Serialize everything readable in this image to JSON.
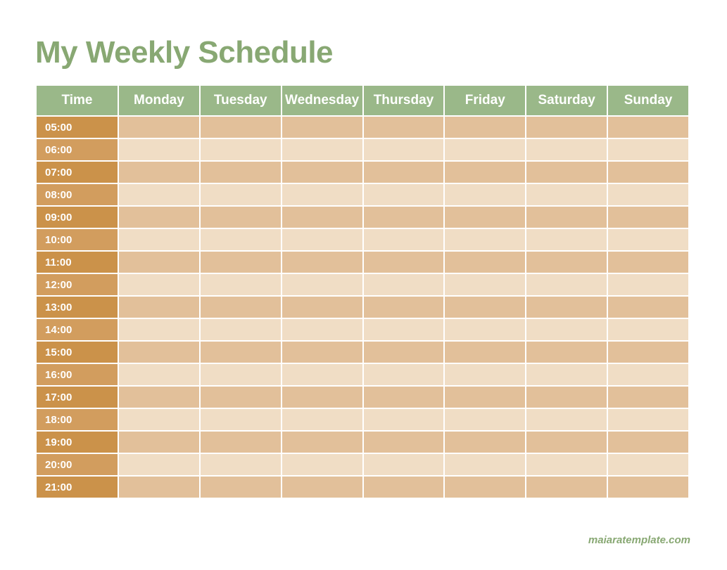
{
  "title": "My Weekly Schedule",
  "columns": {
    "time_header": "Time",
    "days": [
      "Monday",
      "Tuesday",
      "Wednesday",
      "Thursday",
      "Friday",
      "Saturday",
      "Sunday"
    ]
  },
  "rows": [
    {
      "time": "05:00",
      "cells": [
        "",
        "",
        "",
        "",
        "",
        "",
        ""
      ]
    },
    {
      "time": "06:00",
      "cells": [
        "",
        "",
        "",
        "",
        "",
        "",
        ""
      ]
    },
    {
      "time": "07:00",
      "cells": [
        "",
        "",
        "",
        "",
        "",
        "",
        ""
      ]
    },
    {
      "time": "08:00",
      "cells": [
        "",
        "",
        "",
        "",
        "",
        "",
        ""
      ]
    },
    {
      "time": "09:00",
      "cells": [
        "",
        "",
        "",
        "",
        "",
        "",
        ""
      ]
    },
    {
      "time": "10:00",
      "cells": [
        "",
        "",
        "",
        "",
        "",
        "",
        ""
      ]
    },
    {
      "time": "11:00",
      "cells": [
        "",
        "",
        "",
        "",
        "",
        "",
        ""
      ]
    },
    {
      "time": "12:00",
      "cells": [
        "",
        "",
        "",
        "",
        "",
        "",
        ""
      ]
    },
    {
      "time": "13:00",
      "cells": [
        "",
        "",
        "",
        "",
        "",
        "",
        ""
      ]
    },
    {
      "time": "14:00",
      "cells": [
        "",
        "",
        "",
        "",
        "",
        "",
        ""
      ]
    },
    {
      "time": "15:00",
      "cells": [
        "",
        "",
        "",
        "",
        "",
        "",
        ""
      ]
    },
    {
      "time": "16:00",
      "cells": [
        "",
        "",
        "",
        "",
        "",
        "",
        ""
      ]
    },
    {
      "time": "17:00",
      "cells": [
        "",
        "",
        "",
        "",
        "",
        "",
        ""
      ]
    },
    {
      "time": "18:00",
      "cells": [
        "",
        "",
        "",
        "",
        "",
        "",
        ""
      ]
    },
    {
      "time": "19:00",
      "cells": [
        "",
        "",
        "",
        "",
        "",
        "",
        ""
      ]
    },
    {
      "time": "20:00",
      "cells": [
        "",
        "",
        "",
        "",
        "",
        "",
        ""
      ]
    },
    {
      "time": "21:00",
      "cells": [
        "",
        "",
        "",
        "",
        "",
        "",
        ""
      ]
    }
  ],
  "footer": "maiaratemplate.com"
}
